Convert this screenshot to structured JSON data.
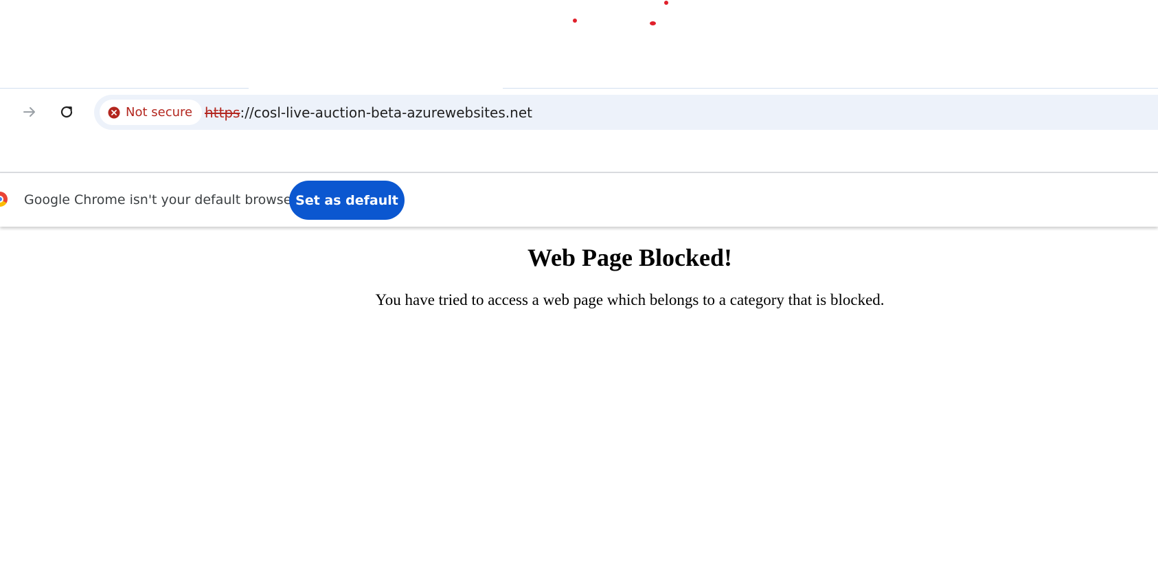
{
  "toolbar": {
    "forward_icon": "arrow-right-icon",
    "reload_icon": "reload-icon",
    "security": {
      "icon": "error-circle-icon",
      "label": "Not secure",
      "color": "#b3261e"
    },
    "url": {
      "scheme": "https",
      "rest": "://cosl-live-auction-beta-azurewebsites.net"
    }
  },
  "infobar": {
    "logo": "chrome-logo-icon",
    "message": "Google Chrome isn't your default browser",
    "button_label": "Set as default",
    "button_color": "#0b57d0"
  },
  "page": {
    "heading": "Web Page Blocked!",
    "message": "You have tried to access a web page which belongs to a category that is blocked."
  }
}
